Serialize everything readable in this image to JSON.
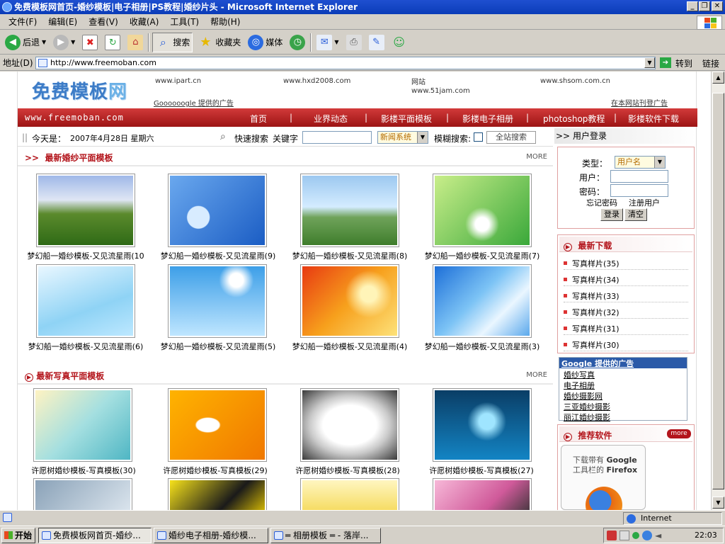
{
  "window": {
    "title": "免费模板网首页-婚纱模板|电子相册|PS教程|婚纱片头 - Microsoft Internet Explorer",
    "min": "_",
    "max": "❐",
    "close": "✕"
  },
  "menu": [
    "文件(F)",
    "编辑(E)",
    "查看(V)",
    "收藏(A)",
    "工具(T)",
    "帮助(H)"
  ],
  "toolbar": {
    "back": "后退",
    "search": "搜索",
    "favorites": "收藏夹",
    "media": "媒体"
  },
  "address": {
    "label": "地址(D)",
    "url": "http://www.freemoban.com",
    "go": "转到",
    "links": "链接"
  },
  "header": {
    "logo_a": "免费模板",
    "logo_b": "网",
    "ads": [
      "www.ipart.cn",
      "www.hxd2008.com",
      "网站",
      "www.51jam.com",
      "www.shsom.com.cn"
    ],
    "google_ad": "Goooooogle 提供的广告",
    "own_ad": "在本网站刊登广告"
  },
  "nav": {
    "site": "www.freemoban.com",
    "items": [
      "首页",
      "业界动态",
      "影楼平面模板",
      "影楼电子相册",
      "photoshop教程",
      "影楼软件下载"
    ]
  },
  "datebar": {
    "today_label": "今天是：",
    "date": "2007年4月28日 星期六",
    "quick_search": "快速搜索",
    "keyword": "关键字",
    "category": "新闻系统",
    "fuzzy": "模糊搜索:",
    "site_search": "全站搜索"
  },
  "sections": [
    {
      "title": "最新婚纱平面模板",
      "more": "MORE",
      "items": [
        "梦幻船一婚纱模板-又见流星雨(10",
        "梦幻船一婚纱模板-又见流星雨(9)",
        "梦幻船一婚纱模板-又见流星雨(8)",
        "梦幻船一婚纱模板-又见流星雨(7)",
        "梦幻船一婚纱模板-又见流星雨(6)",
        "梦幻船一婚纱模板-又见流星雨(5)",
        "梦幻船一婚纱模板-又见流星雨(4)",
        "梦幻船一婚纱模板-又见流星雨(3)"
      ]
    },
    {
      "title": "最新写真平面模板",
      "more": "MORE",
      "items": [
        "许愿树婚纱模板-写真模板(30)",
        "许愿树婚纱模板-写真模板(29)",
        "许愿树婚纱模板-写真模板(28)",
        "许愿树婚纱模板-写真模板(27)"
      ]
    }
  ],
  "login": {
    "title": "用户登录",
    "type_label": "类型：",
    "type_value": "用户名",
    "user_label": "用户：",
    "pass_label": "密码：",
    "forgot": "忘记密码",
    "register": "注册用户",
    "login_btn": "登录",
    "clear_btn": "清空"
  },
  "downloads": {
    "title": "最新下载",
    "items": [
      "写真样片(35)",
      "写真样片(34)",
      "写真样片(33)",
      "写真样片(32)",
      "写真样片(31)",
      "写真样片(30)"
    ]
  },
  "google_ads": {
    "title": "Google 提供的广告",
    "items": [
      "婚纱写真",
      "电子相册",
      "婚纱摄影网",
      "三亚婚纱摄影",
      "丽江婚纱摄影"
    ]
  },
  "software": {
    "title": "推荐软件",
    "more": "more",
    "line1_a": "下载带有",
    "line1_b": "Google",
    "line2_a": "工具栏的",
    "line2_b": "Firefox"
  },
  "status": {
    "zone": "Internet"
  },
  "taskbar": {
    "start": "开始",
    "tasks": [
      "免费模板网首页-婚纱...",
      "婚纱电子相册-婚纱模...",
      "═ 相册模板 ═ - 落岸..."
    ],
    "clock": "22:03"
  },
  "colors": {
    "accent_red": "#b3141b",
    "title_blue": "#0a3cb8"
  }
}
